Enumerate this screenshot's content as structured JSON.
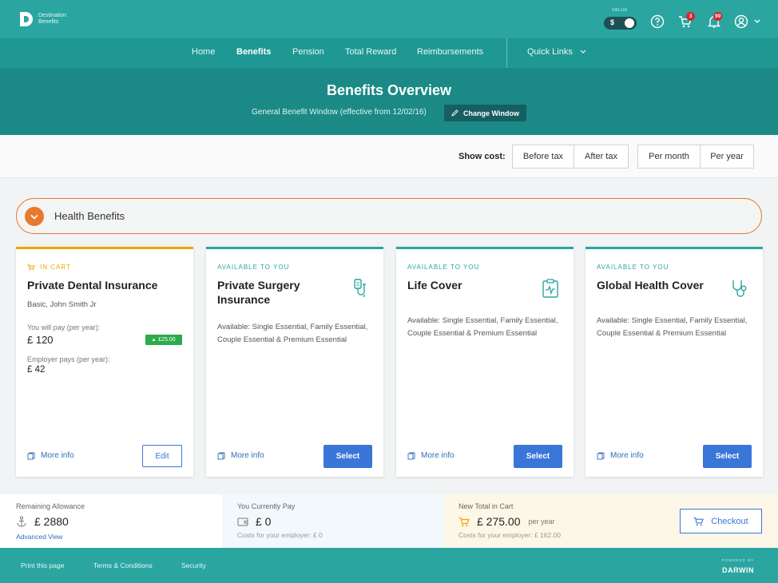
{
  "brand": {
    "line1": "Destination",
    "line2": "Benefits"
  },
  "topbar": {
    "value_label": "VALUE",
    "currency_symbol": "$",
    "cart_count": "3",
    "notifications_count": "99"
  },
  "nav": {
    "items": [
      "Home",
      "Benefits",
      "Pension",
      "Total Reward",
      "Reimbursements"
    ],
    "active": "Benefits",
    "quick_links": "Quick Links"
  },
  "hero": {
    "title": "Benefits Overview",
    "subtitle": "General Benefit Window (effective from 12/02/16)",
    "change_window": "Change Window"
  },
  "cost": {
    "label": "Show cost:",
    "tax_options": [
      "Before tax",
      "After tax"
    ],
    "period_options": [
      "Per month",
      "Per year"
    ]
  },
  "section": {
    "title": "Health Benefits"
  },
  "cards": [
    {
      "status": "IN CART",
      "title": "Private Dental Insurance",
      "detail": "Basic, John Smith Jr",
      "you_pay_label": "You will pay (per year):",
      "you_pay_value": "£ 120",
      "saving_badge": "£25.00",
      "employer_label": "Employer pays (per year):",
      "employer_value": "£ 42",
      "more_info": "More info",
      "action": "Edit"
    },
    {
      "status": "AVAILABLE TO YOU",
      "title_line1": "Private Surgery",
      "title_line2": "Insurance",
      "icon": "drip-icon",
      "desc": "Available: Single Essential, Family Essential, Couple Essential & Premium Essential",
      "more_info": "More info",
      "action": "Select"
    },
    {
      "status": "AVAILABLE TO YOU",
      "title": "Life Cover",
      "icon": "heart-monitor-icon",
      "desc": "Available: Single Essential, Family Essential, Couple Essential & Premium Essential",
      "more_info": "More info",
      "action": "Select"
    },
    {
      "status": "AVAILABLE TO YOU",
      "title": "Global Health Cover",
      "icon": "stethoscope-icon",
      "desc": "Available: Single Essential, Family Essential, Couple Essential & Premium Essential",
      "more_info": "More info",
      "action": "Select"
    }
  ],
  "summary": {
    "remaining_label": "Remaining Allowance",
    "remaining_value": "£ 2880",
    "advanced_view": "Advanced View",
    "current_label": "You Currently Pay",
    "current_value": "£ 0",
    "current_note": "Costs for your employer: £ 0",
    "new_label": "New Total in Cart",
    "new_value": "£ 275.00",
    "new_period": "per year",
    "new_note": "Costs for your employer: £ 162.00",
    "checkout": "Checkout"
  },
  "footer": {
    "links": [
      "Print this page",
      "Terms & Conditions",
      "Security"
    ],
    "powered_by": "POWERED BY",
    "brand": "DARWIN"
  },
  "colors": {
    "teal": "#2aa5a0",
    "teal_dark": "#1b8a86",
    "orange": "#e87a2e",
    "blue": "#3a76d8",
    "gold": "#f0a500",
    "green": "#2cab4a"
  }
}
